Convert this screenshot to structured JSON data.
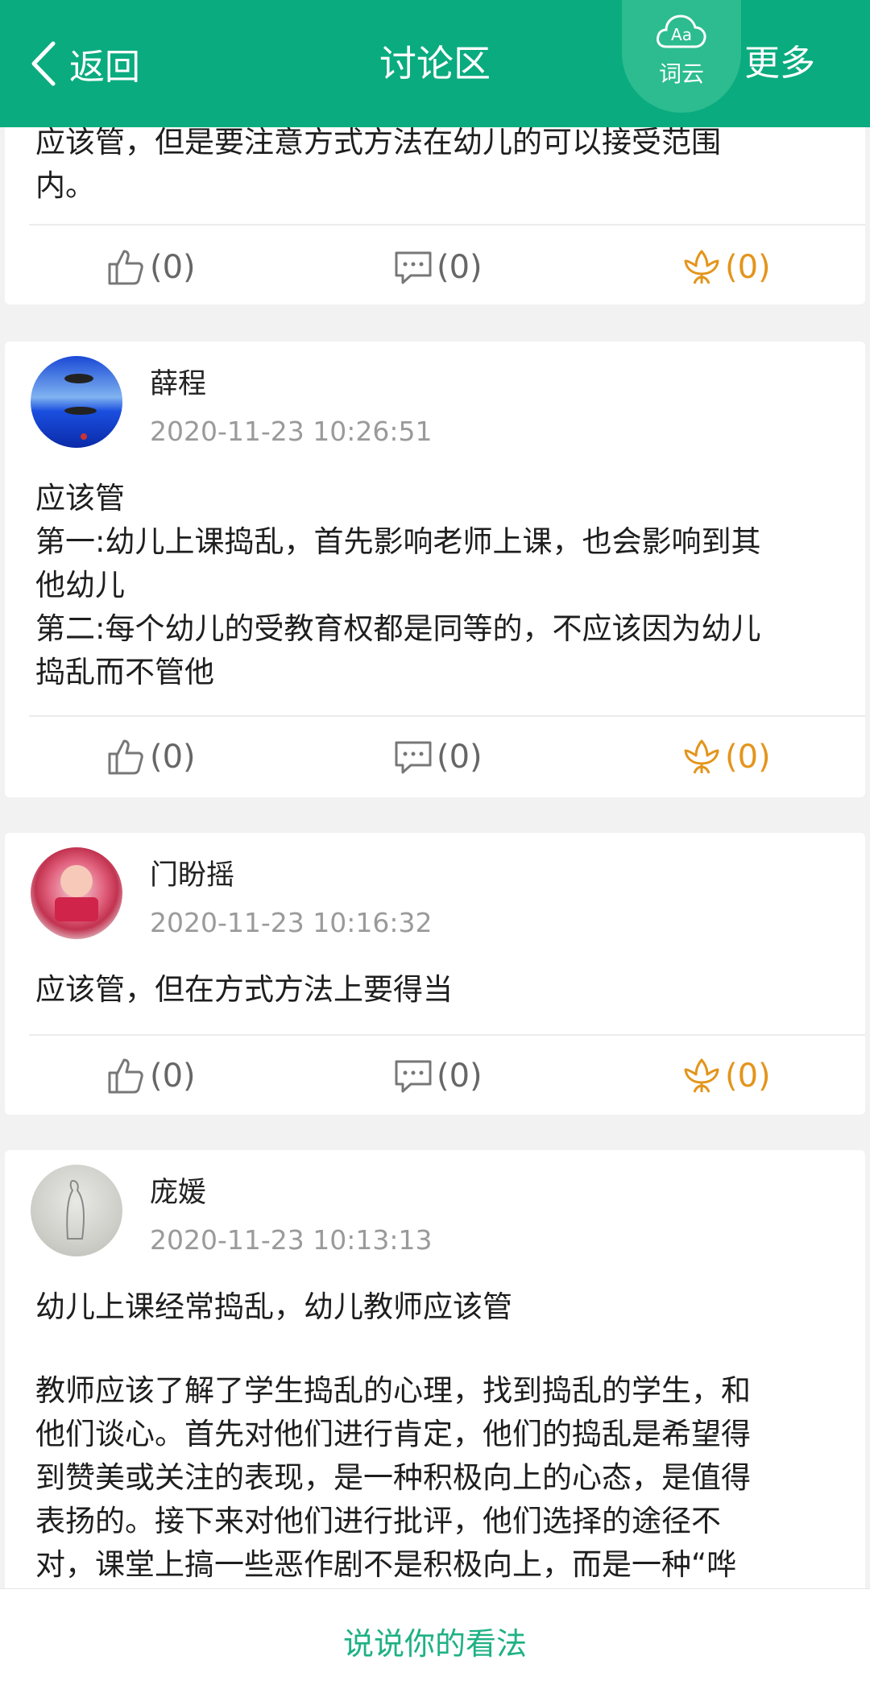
{
  "header": {
    "back_label": "返回",
    "title": "讨论区",
    "cloud_icon_text": "Aa",
    "cloud_label": "词云",
    "more_label": "更多"
  },
  "posts": [
    {
      "author": "",
      "time": "",
      "content_lines": [
        "应该管，但是要注意方式方法在幼儿的可以接受范围",
        "内。"
      ],
      "likes": "(0)",
      "comments": "(0)",
      "flowers": "(0)"
    },
    {
      "author": "薛程",
      "time": "2020-11-23 10:26:51",
      "content_lines": [
        "应该管",
        "第一:幼儿上课捣乱，首先影响老师上课，也会影响到其",
        "他幼儿",
        "第二:每个幼儿的受教育权都是同等的，不应该因为幼儿",
        "捣乱而不管他"
      ],
      "likes": "(0)",
      "comments": "(0)",
      "flowers": "(0)"
    },
    {
      "author": "门盼摇",
      "time": "2020-11-23 10:16:32",
      "content_lines": [
        "应该管，但在方式方法上要得当"
      ],
      "likes": "(0)",
      "comments": "(0)",
      "flowers": "(0)"
    },
    {
      "author": "庞媛",
      "time": "2020-11-23 10:13:13",
      "content_lines": [
        "幼儿上课经常捣乱，幼儿教师应该管",
        "",
        "教师应该了解了学生捣乱的心理，找到捣乱的学生，和",
        "他们谈心。首先对他们进行肯定，他们的捣乱是希望得",
        "到赞美或关注的表现，是一种积极向上的心态，是值得",
        "表扬的。接下来对他们进行批评，他们选择的途径不",
        "对，课堂上搞一些恶作剧不是积极向上，而是一种“哗"
      ],
      "likes": "",
      "comments": "",
      "flowers": ""
    }
  ],
  "bottom": {
    "prompt": "说说你的看法"
  },
  "colors": {
    "brand": "#0aab7f",
    "flower": "#e3951c",
    "prompt": "#1fb184"
  },
  "icons": [
    "chevron-left-icon",
    "word-cloud-icon",
    "thumbs-up-icon",
    "comment-icon",
    "flower-icon"
  ]
}
